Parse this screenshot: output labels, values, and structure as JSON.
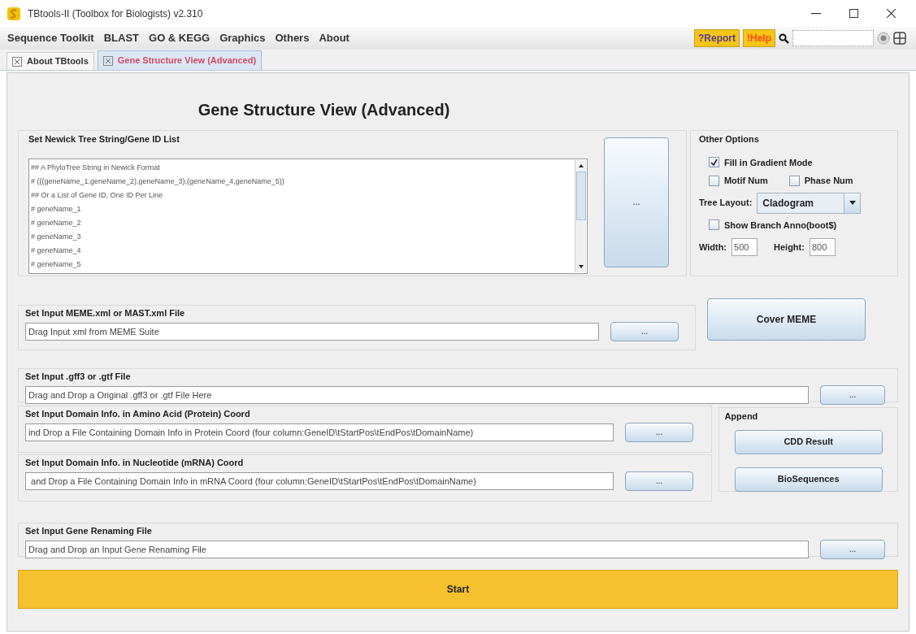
{
  "window": {
    "title": "TBtools-II (Toolbox for Biologists) v2.310"
  },
  "menu": [
    "Sequence Toolkit",
    "BLAST",
    "GO & KEGG",
    "Graphics",
    "Others",
    "About"
  ],
  "toolbar": {
    "report": "?Report",
    "help": "!Help"
  },
  "tabs": [
    {
      "label": "About TBtools",
      "selected": false
    },
    {
      "label": "Gene Structure View (Advanced)",
      "selected": true
    }
  ],
  "heading": "Gene Structure View (Advanced)",
  "tree_input": {
    "label": "Set Newick Tree String/Gene ID List",
    "lines": [
      "## A PhyloTree String in Newick Format",
      "# (((geneName_1,geneName_2),geneName_3),(geneName_4,geneName_5))",
      "## Or a List of Gene ID, One ID Per Line",
      "# geneName_1",
      "# geneName_2",
      "# geneName_3",
      "# geneName_4",
      "# geneName_5"
    ],
    "button": "..."
  },
  "other_options": {
    "title": "Other Options",
    "checkboxes": [
      {
        "label": "Fill in Gradient Mode",
        "checked": true
      },
      {
        "label": "Motif Num",
        "checked": false
      },
      {
        "label": "Phase Num",
        "checked": false
      },
      {
        "label": "Show Branch Anno(boot$)",
        "checked": false
      }
    ],
    "tree_layout": {
      "label": "Tree Layout:",
      "value": "Cladogram"
    },
    "width": {
      "label": "Width:",
      "value": "500"
    },
    "height": {
      "label": "Height:",
      "value": "800"
    }
  },
  "meme_input": {
    "label": "Set Input MEME.xml or MAST.xml File",
    "value": "Drag Input xml from MEME Suite",
    "button": "..."
  },
  "cover_meme": "Cover MEME",
  "gff_input": {
    "label": "Set Input .gff3 or .gtf File",
    "value": "Drag and Drop a Original .gff3 or .gtf File Here",
    "button": "..."
  },
  "domain_inputs": [
    {
      "label": "Set Input Domain Info. in Amino Acid (Protein) Coord",
      "value": "ind Drop a File Containing Domain Info in Protein Coord (four column:GeneID\\tStartPos\\tEndPos\\tDomainName)",
      "button": "..."
    },
    {
      "label": "Set Input Domain Info. in Nucleotide (mRNA) Coord",
      "value": " and Drop a File Containing Domain Info in mRNA Coord (four column:GeneID\\tStartPos\\tEndPos\\tDomainName)",
      "button": "..."
    }
  ],
  "append": {
    "title": "Append",
    "buttons": [
      "CDD Result",
      "BioSequences"
    ]
  },
  "rename_input": {
    "label": "Set Input Gene Renaming File",
    "value": "Drag and Drop an Input Gene Renaming File",
    "button": "..."
  },
  "start": "Start"
}
